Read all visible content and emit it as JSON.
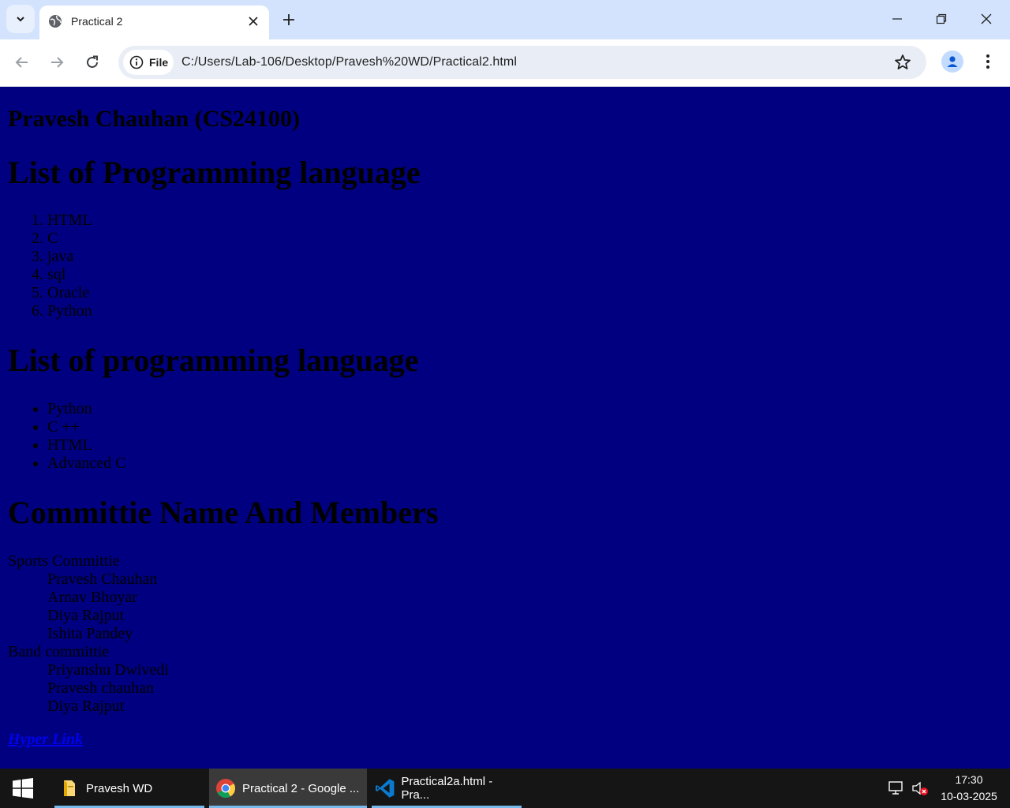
{
  "browser": {
    "tab_title": "Practical 2",
    "site_chip_label": "File",
    "url": "C:/Users/Lab-106/Desktop/Pravesh%20WD/Practical2.html"
  },
  "page": {
    "author_heading": "Pravesh Chauhan (CS24100)",
    "ordered_heading": "List of Programming language",
    "ordered_items": [
      "HTML",
      "C",
      "java",
      "sql",
      "Oracle",
      "Python"
    ],
    "unordered_heading": "List of programming language",
    "unordered_items": [
      "Python",
      "C ++",
      "HTML",
      "Advanced C"
    ],
    "committee_heading": "Committie Name And Members",
    "committees": [
      {
        "name": "Sports Committie",
        "members": [
          "Pravesh Chauhan",
          "Arnav Bhoyar",
          "Diya Rajput",
          "Ishita Pandey"
        ]
      },
      {
        "name": "Band committie",
        "members": [
          "Priyanshu Dwivedi",
          "Pravesh chauhan",
          "Diya Rajput"
        ]
      }
    ],
    "link_text": "Hyper Link",
    "background_color": "#000080",
    "text_color": "#000000",
    "link_color": "#0000ee"
  },
  "taskbar": {
    "items": [
      {
        "label": "Pravesh WD",
        "icon": "folder-icon"
      },
      {
        "label": "Practical 2 - Google ...",
        "icon": "chrome-icon"
      },
      {
        "label": "Practical2a.html - Pra...",
        "icon": "vscode-icon"
      }
    ],
    "time": "17:30",
    "date": "10-03-2025"
  }
}
